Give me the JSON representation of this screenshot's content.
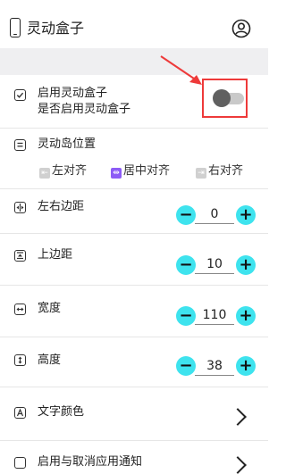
{
  "header": {
    "title": "灵动盒子"
  },
  "enable": {
    "title": "启用灵动盒子",
    "subtitle": "是否启用灵动盒子",
    "enabled": false
  },
  "island_position": {
    "title": "灵动岛位置",
    "options": [
      "左对齐",
      "居中对齐",
      "右对齐"
    ],
    "selected": "居中对齐"
  },
  "margin_lr": {
    "label": "左右边距",
    "value": "0"
  },
  "margin_top": {
    "label": "上边距",
    "value": "10"
  },
  "width": {
    "label": "宽度",
    "value": "110"
  },
  "height": {
    "label": "高度",
    "value": "38"
  },
  "text_color": {
    "label": "文字颜色"
  },
  "notify": {
    "label": "启用与取消应用通知"
  },
  "stepper": {
    "minus": "−",
    "plus": "+"
  },
  "colors": {
    "accent": "#3ee3ee",
    "highlight": "#ee3a3a",
    "selected_align": "#8d5cf6"
  }
}
